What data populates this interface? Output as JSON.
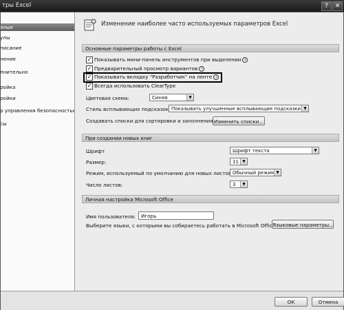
{
  "window": {
    "title": "тры Excel"
  },
  "sidebar": {
    "items": [
      {
        "label": "вные"
      },
      {
        "label": "улы"
      },
      {
        "label": "писание"
      },
      {
        "label": "нение"
      },
      {
        "label": "лнительно"
      },
      {
        "label": "ройка"
      },
      {
        "label": "ройки"
      },
      {
        "label": "р управления безопасностью"
      },
      {
        "label": "сы"
      }
    ]
  },
  "header": {
    "title": "Изменение наиболее часто используемых параметров Excel"
  },
  "sections": {
    "main_options": {
      "title": "Основные параметры работы с Excel",
      "mini_toolbar_label": "Показывать мини-панель инструментов при выделении",
      "live_preview_label": "Предварительный просмотр вариантов",
      "developer_tab_label": "Показывать вкладку \"Разработчик\" на ленте",
      "cleartype_label": "Всегда использовать ClearType",
      "color_scheme_label": "Цветовая схема:",
      "color_scheme_value": "Синяя",
      "tooltip_style_label": "Стиль всплывающих подсказок:",
      "tooltip_style_value": "Показывать улучшенные всплывающие подсказки",
      "custom_lists_label": "Создавать списки для сортировки и заполнения:",
      "edit_lists_button": "Изменить списки..."
    },
    "new_workbooks": {
      "title": "При создании новых книг",
      "font_label": "Шрифт",
      "font_value": "Шрифт текста",
      "size_label": "Размер:",
      "size_value": "11",
      "view_label": "Режим, используемый по умолчанию для новых листов:",
      "view_value": "Обычный режим",
      "sheets_label": "Число листов:",
      "sheets_value": "3"
    },
    "personalize": {
      "title": "Личная настройка Microsoft Office",
      "username_label": "Имя пользователя:",
      "username_value": "Игорь",
      "languages_label": "Выберите языки, с которыми вы собираетесь работать в Microsoft Office:",
      "language_settings_button": "Языковые параметры..."
    }
  },
  "footer": {
    "ok_label": "ОК",
    "cancel_label": "Отмена"
  },
  "icons": {
    "info": "i",
    "check": "✓",
    "dropdown": "▼",
    "close": "✕"
  }
}
